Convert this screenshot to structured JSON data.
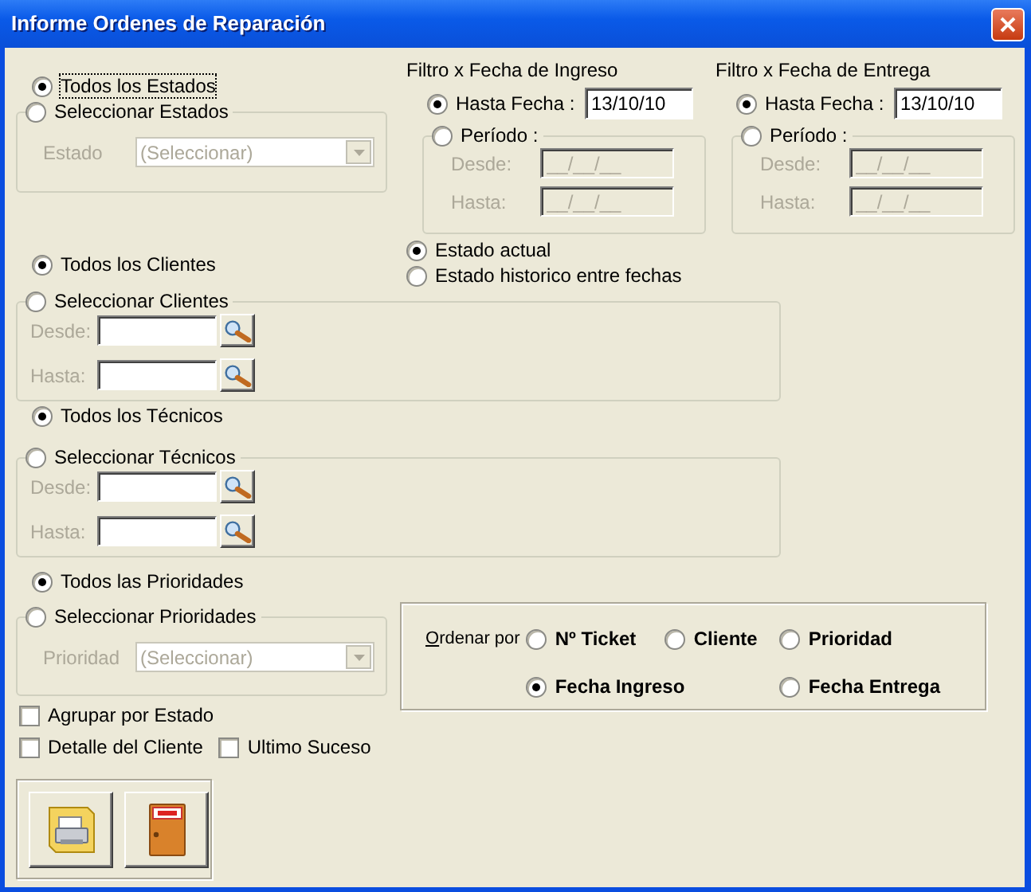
{
  "window": {
    "title": "Informe Ordenes de Reparación"
  },
  "estados": {
    "all": {
      "label": "Todos los Estados",
      "selected": true,
      "focused": true
    },
    "select": {
      "label": "Seleccionar Estados",
      "selected": false
    },
    "enabled": false,
    "field_label": "Estado",
    "combo_value": "(Seleccionar)"
  },
  "fecha_ingreso": {
    "title": "Filtro x Fecha de Ingreso",
    "hasta": {
      "label": "Hasta Fecha :",
      "selected": true,
      "value": "13/10/10"
    },
    "periodo": {
      "label": "Período :",
      "selected": false
    },
    "enabled": false,
    "rows": [
      {
        "label": "Desde:",
        "value": "__/__/__"
      },
      {
        "label": "Hasta:",
        "value": "__/__/__"
      }
    ]
  },
  "fecha_entrega": {
    "title": "Filtro x Fecha de Entrega",
    "hasta": {
      "label": "Hasta Fecha :",
      "selected": true,
      "value": "13/10/10"
    },
    "periodo": {
      "label": "Período :",
      "selected": false
    },
    "enabled": false,
    "rows": [
      {
        "label": "Desde:",
        "value": "__/__/__"
      },
      {
        "label": "Hasta:",
        "value": "__/__/__"
      }
    ]
  },
  "estado_modo": [
    {
      "label": "Estado actual",
      "selected": true
    },
    {
      "label": "Estado historico entre fechas",
      "selected": false
    }
  ],
  "clientes": {
    "all": {
      "label": "Todos los Clientes",
      "selected": true
    },
    "select": {
      "label": "Seleccionar Clientes",
      "selected": false
    },
    "enabled": false,
    "rows": [
      {
        "label": "Desde:"
      },
      {
        "label": "Hasta:"
      }
    ]
  },
  "tecnicos": {
    "all": {
      "label": "Todos los Técnicos",
      "selected": true
    },
    "select": {
      "label": "Seleccionar Técnicos",
      "selected": false
    },
    "enabled": false,
    "rows": [
      {
        "label": "Desde:"
      },
      {
        "label": "Hasta:"
      }
    ]
  },
  "prioridades": {
    "all": {
      "label": "Todos las Prioridades",
      "selected": true
    },
    "select": {
      "label": "Seleccionar Prioridades",
      "selected": false
    },
    "enabled": false,
    "field_label": "Prioridad",
    "combo_value": "(Seleccionar)"
  },
  "checkboxes": [
    {
      "label": "Agrupar por Estado",
      "checked": false
    },
    {
      "label": "Detalle del Cliente",
      "checked": false
    },
    {
      "label": "Ultimo Suceso",
      "checked": false
    }
  ],
  "ordenar": {
    "label": "Ordenar por",
    "options": [
      {
        "label": "Nº Ticket",
        "selected": false
      },
      {
        "label": "Cliente",
        "selected": false
      },
      {
        "label": "Prioridad",
        "selected": false
      },
      {
        "label": "Fecha Ingreso",
        "selected": true
      },
      {
        "label": "Fecha Entrega",
        "selected": false
      }
    ]
  }
}
